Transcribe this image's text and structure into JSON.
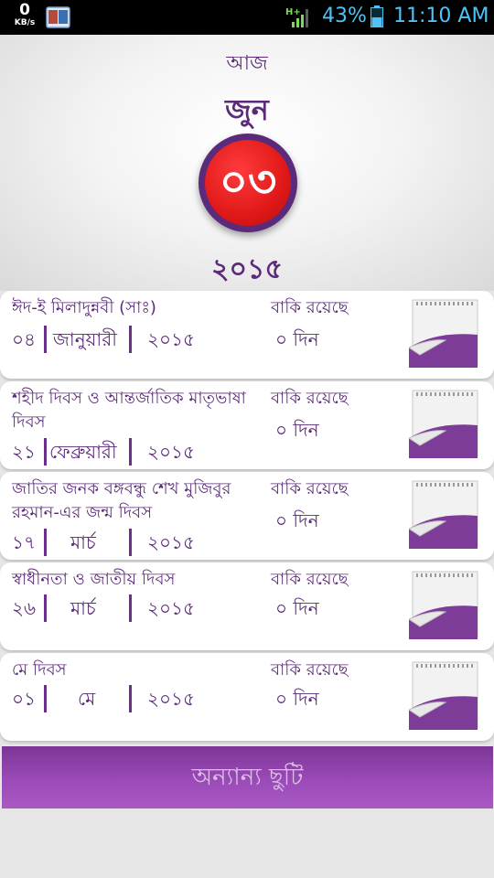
{
  "status_bar": {
    "speed_value": "0",
    "speed_unit": "KB/s",
    "app_icon": "book-calendar-icon",
    "signal": "H+",
    "battery_percent": "43%",
    "time": "11:10 AM",
    "text_color": "#4fc3f7"
  },
  "today": {
    "label": "আজ",
    "month": "জুন",
    "day": "০৩",
    "year": "২০১৫"
  },
  "holidays": [
    {
      "name": "ঈদ-ই মিলাদুন্নবী (সাঃ)",
      "day": "০৪",
      "month": "জানুয়ারী",
      "year": "২০১৫",
      "remaining_label": "বাকি রয়েছে",
      "remaining_days": "০ দিন"
    },
    {
      "name": "শহীদ দিবস ও আন্তর্জাতিক মাতৃভাষা দিবস",
      "day": "২১",
      "month": "ফেব্রুয়ারী",
      "year": "২০১৫",
      "remaining_label": "বাকি রয়েছে",
      "remaining_days": "০ দিন"
    },
    {
      "name": "জাতির জনক বঙ্গবন্ধু শেখ মুজিবুর রহমান-এর জন্ম দিবস",
      "day": "১৭",
      "month": "মার্চ",
      "year": "২০১৫",
      "remaining_label": "বাকি রয়েছে",
      "remaining_days": "০ দিন"
    },
    {
      "name": "স্বাধীনতা ও জাতীয় দিবস",
      "day": "২৬",
      "month": "মার্চ",
      "year": "২০১৫",
      "remaining_label": "বাকি রয়েছে",
      "remaining_days": "০ দিন"
    },
    {
      "name": "মে দিবস",
      "day": "০১",
      "month": "মে",
      "year": "২০১৫",
      "remaining_label": "বাকি রয়েছে",
      "remaining_days": "০ দিন"
    }
  ],
  "more_button": {
    "label": "অন্যান্য ছুটি"
  },
  "colors": {
    "accent_purple": "#5b2a7a",
    "button_purple": "#9b4ab8",
    "day_red": "#e01818"
  }
}
